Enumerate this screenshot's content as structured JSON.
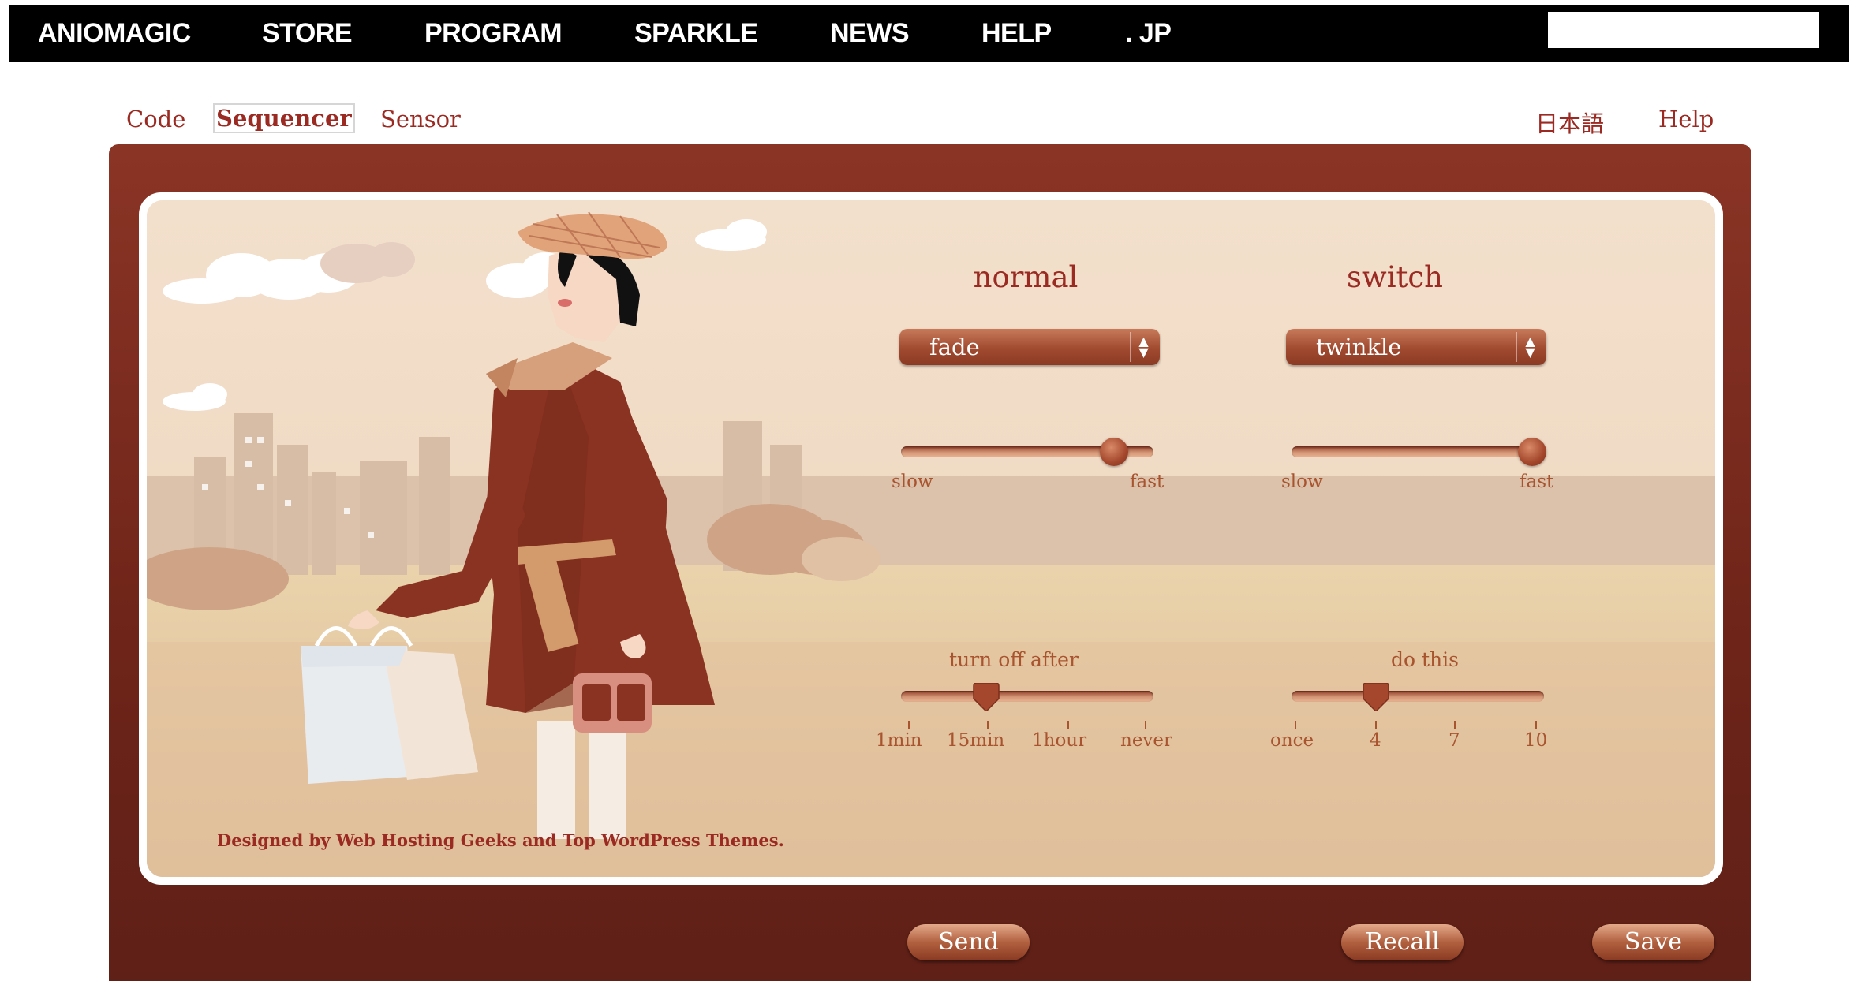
{
  "nav": {
    "items": [
      "ANIOMAGIC",
      "STORE",
      "PROGRAM",
      "SPARKLE",
      "NEWS",
      "HELP",
      ". JP"
    ],
    "search": {
      "value": "",
      "placeholder": ""
    }
  },
  "tabs": {
    "code": "Code",
    "sequencer": "Sequencer",
    "sensor": "Sensor",
    "japanese": "日本語",
    "help": "Help"
  },
  "normal": {
    "title": "normal",
    "pattern": "fade",
    "speed": {
      "min_label": "slow",
      "max_label": "fast",
      "level": 0.88
    }
  },
  "switch": {
    "title": "switch",
    "pattern": "twinkle",
    "speed": {
      "min_label": "slow",
      "max_label": "fast",
      "level": 1.0
    }
  },
  "turn_off": {
    "title": "turn off after",
    "ticks": [
      "1min",
      "15min",
      "1hour",
      "never"
    ],
    "selected": "15min"
  },
  "do_this": {
    "title": "do this",
    "ticks": [
      "once",
      "4",
      "7",
      "10"
    ],
    "selected": "4"
  },
  "credit": "Designed by Web Hosting Geeks and Top WordPress Themes.",
  "buttons": {
    "send": "Send",
    "recall": "Recall",
    "save": "Save"
  }
}
